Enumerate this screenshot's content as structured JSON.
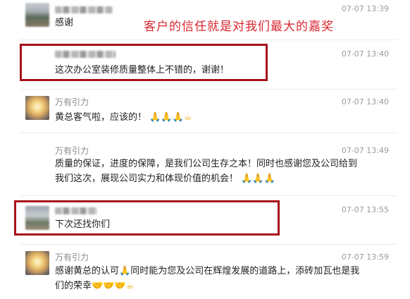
{
  "caption": "客户的信任就是对我们最大的嘉奖",
  "messages": [
    {
      "sender": "",
      "time": "07-07 13:39",
      "text": "感谢"
    },
    {
      "sender": "",
      "time": "07-07 13:40",
      "text": "这次办公室装修质量整体上不错的，谢谢！"
    },
    {
      "sender": "万有引力",
      "time": "07-07 13:40",
      "text": "黄总客气啦，应该的！",
      "emoji": "🙏🙏🙏☕"
    },
    {
      "sender": "万有引力",
      "time": "07-07 13:49",
      "text_line1": "质量的保证，进度的保障，是我们公司生存之本！同时也感谢您及公司给到",
      "text_line2": "我们这次，展现公司实力和体现价值的机会！",
      "emoji": "🙏🙏🙏"
    },
    {
      "sender": "",
      "time": "07-07 13:55",
      "text": "下次还找你们"
    },
    {
      "sender": "万有引力",
      "time": "07-07 13:59",
      "text_line1a": "感谢黄总的认可",
      "emoji_mid": "🙏",
      "text_line1b": "同时能为您及公司在辉煌发展的道路上，添砖加瓦也是我",
      "text_line2": "们的荣幸",
      "emoji": "🤝🤝🤝☕"
    }
  ]
}
